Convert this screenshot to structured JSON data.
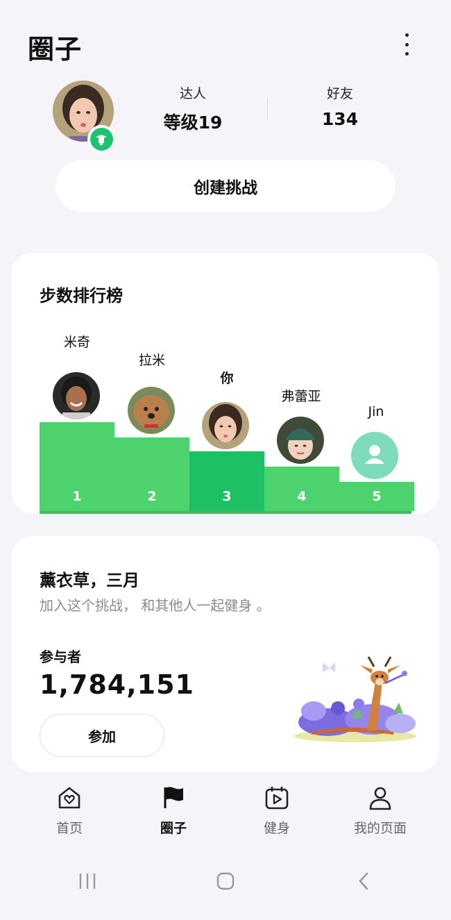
{
  "header": {
    "title": "圈子"
  },
  "profile": {
    "stat_level": {
      "label": "达人",
      "value": "等级19"
    },
    "stat_friends": {
      "label": "好友",
      "value": "134"
    },
    "create_label": "创建挑战"
  },
  "leaderboard": {
    "title": "步数排行榜",
    "entries": [
      {
        "name": "米奇",
        "rank": "1",
        "level": 1.0,
        "me": false
      },
      {
        "name": "拉米",
        "rank": "2",
        "level": 0.83,
        "me": false
      },
      {
        "name": "你",
        "rank": "3",
        "level": 0.67,
        "me": true
      },
      {
        "name": "弗蕾亚",
        "rank": "4",
        "level": 0.5,
        "me": false
      },
      {
        "name": "Jin",
        "rank": "5",
        "level": 0.33,
        "me": false
      }
    ]
  },
  "challenge": {
    "title": "薰衣草，三月",
    "subtitle": "加入这个挑战， 和其他人一起健身 。",
    "participants_label": "参与者",
    "participants_count": "1,784,151",
    "join_label": "参加"
  },
  "nav": {
    "items": [
      {
        "label": "首页",
        "icon": "home-heart-icon"
      },
      {
        "label": "圈子",
        "icon": "flag-icon",
        "active": true
      },
      {
        "label": "健身",
        "icon": "play-calendar-icon"
      },
      {
        "label": "我的页面",
        "icon": "person-icon"
      }
    ]
  },
  "colors": {
    "bar": "#4cd36e",
    "bar_me": "#1ec064",
    "accent": "#1ec46d"
  }
}
